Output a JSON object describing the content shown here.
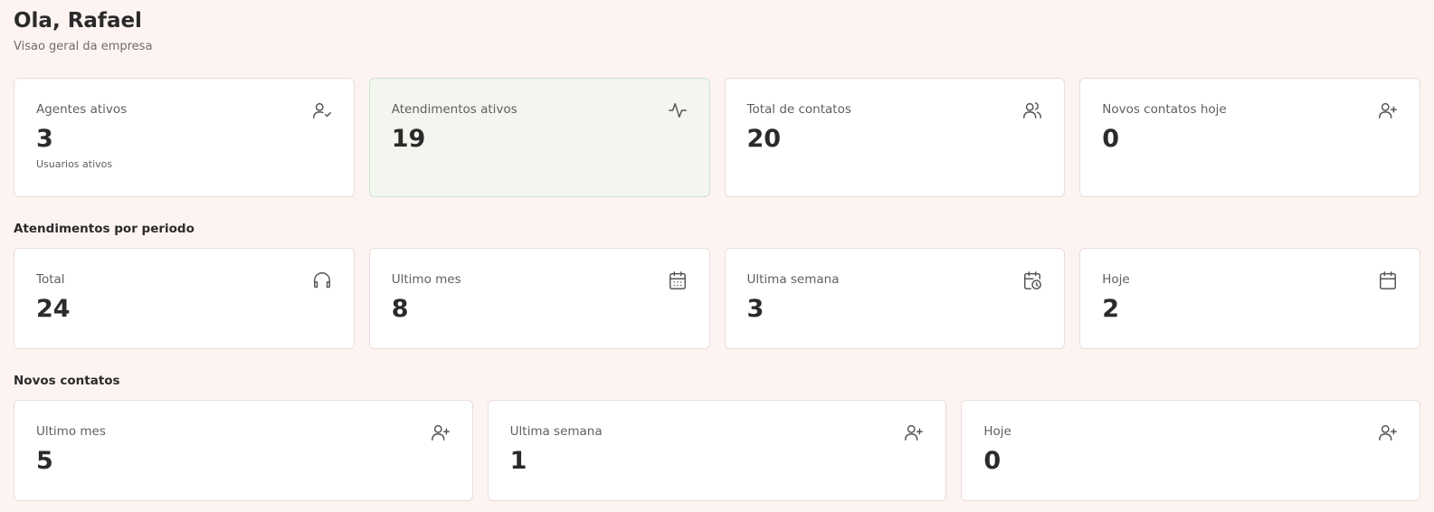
{
  "header": {
    "greeting": "Ola, Rafael",
    "subtitle": "Visao geral da empresa"
  },
  "overview": [
    {
      "label": "Agentes ativos",
      "value": "3",
      "sub": "Usuarios ativos",
      "icon": "user-check-icon"
    },
    {
      "label": "Atendimentos ativos",
      "value": "19",
      "icon": "activity-icon",
      "highlighted": true
    },
    {
      "label": "Total de contatos",
      "value": "20",
      "icon": "users-icon"
    },
    {
      "label": "Novos contatos hoje",
      "value": "0",
      "icon": "user-plus-icon"
    }
  ],
  "period_section": {
    "title": "Atendimentos por periodo",
    "cards": [
      {
        "label": "Total",
        "value": "24",
        "icon": "headphones-icon"
      },
      {
        "label": "Ultimo mes",
        "value": "8",
        "icon": "calendar-days-icon"
      },
      {
        "label": "Ultima semana",
        "value": "3",
        "icon": "calendar-clock-icon"
      },
      {
        "label": "Hoje",
        "value": "2",
        "icon": "calendar-icon"
      }
    ]
  },
  "contacts_section": {
    "title": "Novos contatos",
    "cards": [
      {
        "label": "Ultimo mes",
        "value": "5",
        "icon": "user-plus-icon"
      },
      {
        "label": "Ultima semana",
        "value": "1",
        "icon": "user-plus-icon"
      },
      {
        "label": "Hoje",
        "value": "0",
        "icon": "user-plus-icon"
      }
    ]
  },
  "colors": {
    "background": "#fdf4f2",
    "highlight_card": "#f3f5ef",
    "highlight_border": "#c9e3cf"
  }
}
